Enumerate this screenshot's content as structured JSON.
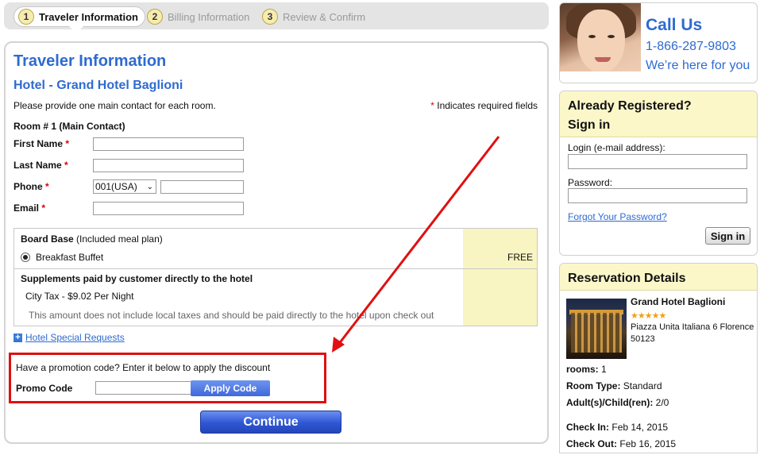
{
  "steps": [
    {
      "num": "1",
      "label": "Traveler Information"
    },
    {
      "num": "2",
      "label": "Billing Information"
    },
    {
      "num": "3",
      "label": "Review & Confirm"
    }
  ],
  "form": {
    "title": "Traveler Information",
    "hotel": "Hotel - Grand Hotel Baglioni",
    "intro": "Please provide one main contact for each room.",
    "required_note": "Indicates required fields",
    "room_title": "Room # 1 (Main Contact)",
    "first_name_label": "First Name",
    "last_name_label": "Last Name",
    "phone_label": "Phone",
    "phone_code": "001(USA)",
    "email_label": "Email",
    "required_mark": "*"
  },
  "board": {
    "title": "Board Base",
    "subtitle": "(Included meal plan)",
    "meal": "Breakfast Buffet",
    "price": "FREE",
    "supplements_title": "Supplements paid by customer directly to the hotel",
    "city_tax": "City Tax - $9.02 Per Night",
    "tax_note": "This amount does not include local taxes and should be paid directly to the hotel upon check out"
  },
  "special_requests": "Hotel Special Requests",
  "promo": {
    "text": "Have a promotion code? Enter it below to apply the discount",
    "label": "Promo Code",
    "apply": "Apply Code"
  },
  "continue_label": "Continue",
  "call": {
    "title": "Call Us",
    "phone": "1-866-287-9803",
    "tagline": "We’re here for you"
  },
  "signin": {
    "title1": "Already Registered?",
    "title2": "Sign in",
    "login_label": "Login (e-mail address):",
    "password_label": "Password:",
    "forgot": "Forgot Your Password?",
    "button": "Sign in"
  },
  "reservation": {
    "title": "Reservation Details",
    "hotel_name": "Grand Hotel Baglioni",
    "stars": "★★★★★",
    "address1": "Piazza Unita Italiana 6 Florence",
    "address2": "50123",
    "rooms_label": "rooms:",
    "rooms_value": "1",
    "room_type_label": "Room Type:",
    "room_type_value": "Standard",
    "guests_label": "Adult(s)/Child(ren):",
    "guests_value": "2/0",
    "checkin_label": "Check In:",
    "checkin_value": "Feb 14, 2015",
    "checkout_label": "Check Out:",
    "checkout_value": "Feb 16, 2015"
  },
  "colors": {
    "accent": "#2f6ad0",
    "highlight": "#e01010"
  }
}
